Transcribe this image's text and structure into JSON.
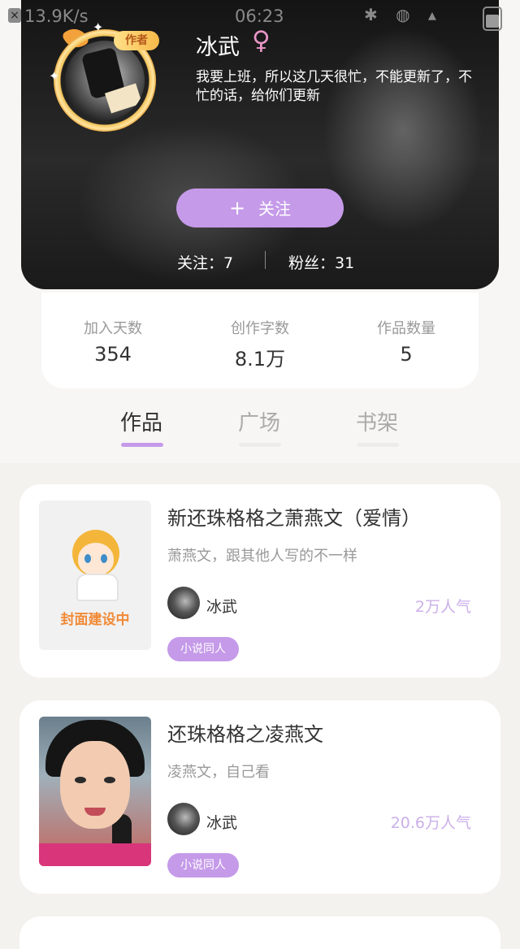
{
  "status_bar": {
    "close_glyph": "×",
    "speed": "13.9K/s",
    "time": "06:23",
    "icons": "✱ ◍ ▴"
  },
  "profile": {
    "badge": "作者",
    "name": "冰武",
    "gender_glyph": "♀",
    "bio": "我要上班，所以这几天很忙，不能更新了，不忙的话，给你们更新",
    "follow_plus": "+",
    "follow_label": "关注",
    "following_label": "关注：7",
    "fans_label": "粉丝：31"
  },
  "stats": [
    {
      "label": "加入天数",
      "value": "354"
    },
    {
      "label": "创作字数",
      "value": "8.1万"
    },
    {
      "label": "作品数量",
      "value": "5"
    }
  ],
  "tabs": [
    "作品",
    "广场",
    "书架"
  ],
  "active_tab": "作品",
  "accent_color": "#c59ae9",
  "books": [
    {
      "cover_caption": "封面建设中",
      "title": "新还珠格格之萧燕文（爱情）",
      "desc": "萧燕文，跟其他人写的不一样",
      "author": "冰武",
      "popularity": "2万人气",
      "tag": "小说同人"
    },
    {
      "title": "还珠格格之凌燕文",
      "desc": "凌燕文，自己看",
      "author": "冰武",
      "popularity": "20.6万人气",
      "tag": "小说同人"
    }
  ]
}
